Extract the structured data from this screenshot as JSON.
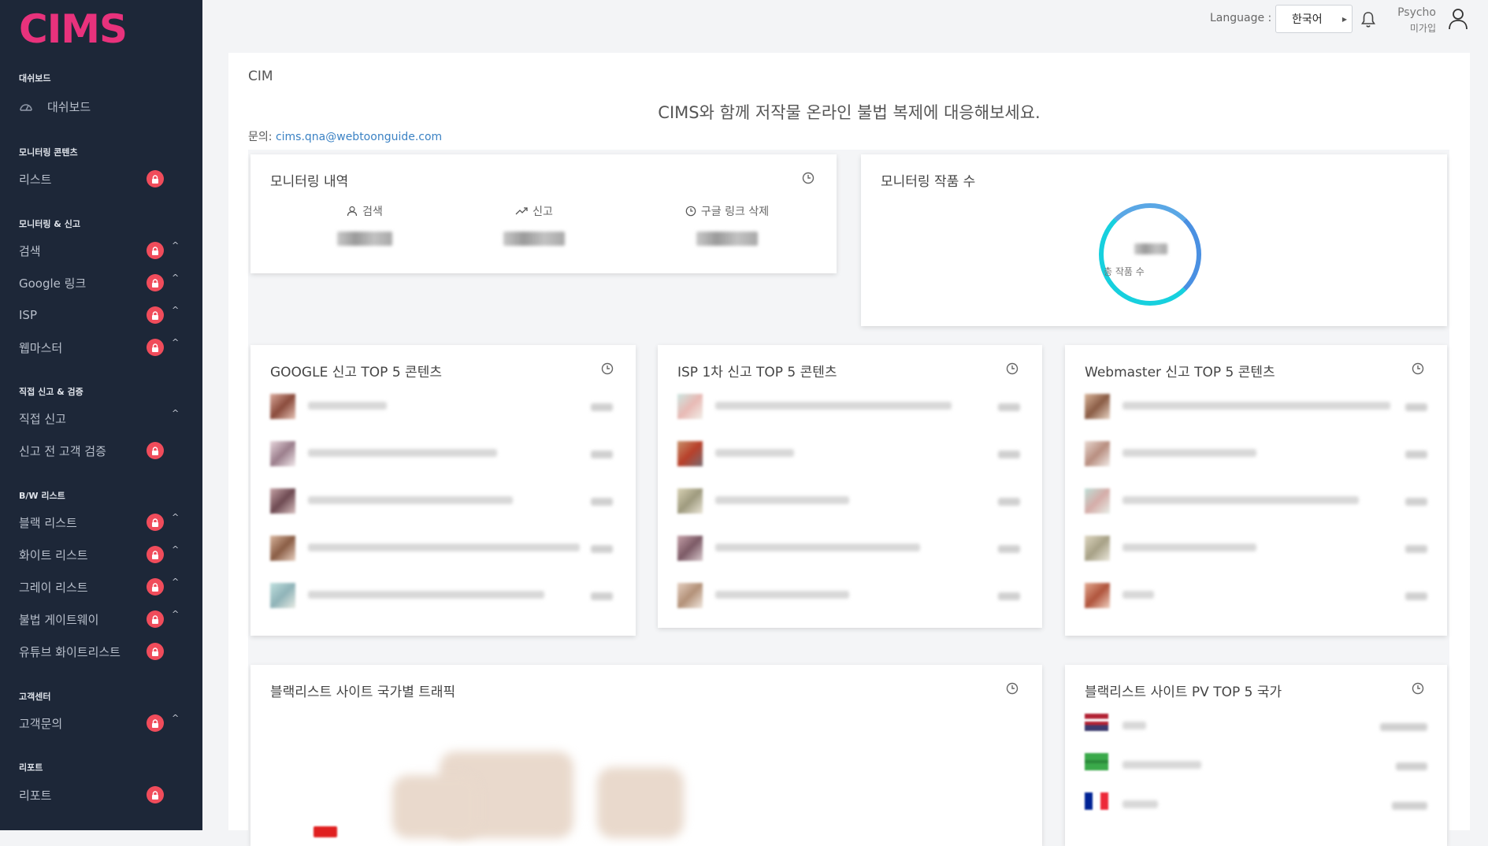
{
  "app": {
    "logo": "CIMS"
  },
  "sidebar": {
    "sections": [
      {
        "title": "대쉬보드",
        "items": [
          {
            "label": "대쉬보드",
            "icon": "gauge-icon"
          }
        ]
      },
      {
        "title": "모니터링 콘텐츠",
        "items": [
          {
            "label": "리스트",
            "locked": true
          }
        ]
      },
      {
        "title": "모니터링 & 신고",
        "items": [
          {
            "label": "검색",
            "locked": true,
            "expandable": true
          },
          {
            "label": "Google 링크",
            "locked": true,
            "expandable": true
          },
          {
            "label": "ISP",
            "locked": true,
            "expandable": true
          },
          {
            "label": "웹마스터",
            "locked": true,
            "expandable": true
          }
        ]
      },
      {
        "title": "직접 신고 & 검증",
        "items": [
          {
            "label": "직접 신고",
            "locked": false,
            "expandable": true
          },
          {
            "label": "신고 전 고객 검증",
            "locked": true
          }
        ]
      },
      {
        "title": "B/W 리스트",
        "items": [
          {
            "label": "블랙 리스트",
            "locked": true,
            "expandable": true
          },
          {
            "label": "화이트 리스트",
            "locked": true,
            "expandable": true
          },
          {
            "label": "그레이 리스트",
            "locked": true,
            "expandable": true
          },
          {
            "label": "불법 게이트웨이",
            "locked": true,
            "expandable": true
          },
          {
            "label": "유튜브 화이트리스트",
            "locked": true
          }
        ]
      },
      {
        "title": "고객센터",
        "items": [
          {
            "label": "고객문의",
            "locked": true,
            "expandable": true
          }
        ]
      },
      {
        "title": "리포트",
        "items": [
          {
            "label": "리포트",
            "locked": true
          }
        ]
      }
    ]
  },
  "topbar": {
    "language_label": "Language :",
    "language_value": "한국어",
    "user_name": "Psycho",
    "user_status": "미가입"
  },
  "main": {
    "breadcrumb": "CIM",
    "headline": "CIMS와 함께 저작물 온라인 불법 복제에 대응해보세요.",
    "contact_label": "문의:",
    "contact_email": "cims.qna@webtoonguide.com"
  },
  "cards": {
    "monitoring_history": {
      "title": "모니터링 내역",
      "stats": [
        {
          "label": "검색",
          "icon": "user-icon"
        },
        {
          "label": "신고",
          "icon": "trend-up-icon"
        },
        {
          "label": "구글 링크 삭제",
          "icon": "clock-icon"
        }
      ]
    },
    "monitoring_works": {
      "title": "모니터링 작품 수",
      "ring_label": "총 작품 수"
    },
    "google_top5": {
      "title": "GOOGLE 신고 TOP 5 콘텐츠"
    },
    "isp_top5": {
      "title": "ISP 1차 신고 TOP 5 콘텐츠"
    },
    "webmaster_top5": {
      "title": "Webmaster 신고 TOP 5 콘텐츠"
    },
    "country_traffic": {
      "title": "블랙리스트 사이트 국가별 트래픽"
    },
    "pv_top5": {
      "title": "블랙리스트 사이트 PV TOP 5 국가"
    }
  },
  "colors": {
    "sidebar_bg": "#1d2738",
    "logo": "#e8327c",
    "lock_badge": "#f04c5b",
    "ring": "#17d0de",
    "link": "#3b82c4"
  }
}
